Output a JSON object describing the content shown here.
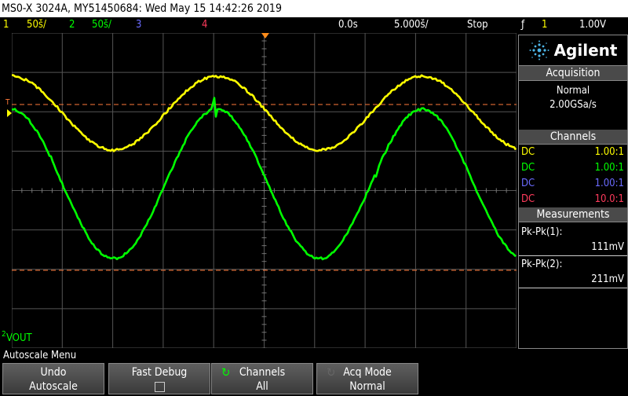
{
  "title": "MS0-X 3024A, MY51450684: Wed May 15 14:42:26 2019",
  "status": {
    "ch1_num": "1",
    "ch1_scale": "50š/",
    "ch2_num": "2",
    "ch2_scale": "50š/",
    "ch3_num": "3",
    "ch4_num": "4",
    "time_offset": "0.0s",
    "time_scale": "5.000š/",
    "run_state": "Stop",
    "trigger_symbol": "ƒ",
    "trigger_channel": "1",
    "trigger_level": "1.00V"
  },
  "markers": {
    "trigger_marker": "T",
    "ground_marker": "2",
    "vout_label": "VOUT"
  },
  "panel": {
    "brand": "Agilent",
    "acquisition_title": "Acquisition",
    "acquisition_mode": "Normal",
    "sample_rate": "2.00GSa/s",
    "channels_title": "Channels",
    "channels": [
      {
        "coupling": "DC",
        "ratio": "1.00:1",
        "color": "#ffff00"
      },
      {
        "coupling": "DC",
        "ratio": "1.00:1",
        "color": "#00ff00"
      },
      {
        "coupling": "DC",
        "ratio": "1.00:1",
        "color": "#6b6bff"
      },
      {
        "coupling": "DC",
        "ratio": "10.0:1",
        "color": "#ff3b5c"
      }
    ],
    "measurements_title": "Measurements",
    "measurements": [
      {
        "name": "Pk-Pk(1):",
        "value": "111mV"
      },
      {
        "name": "Pk-Pk(2):",
        "value": "211mV"
      }
    ]
  },
  "softkeys": {
    "menu_title": "Autoscale Menu",
    "undo_top": "Undo",
    "undo_bottom": "Autoscale",
    "fast_debug": "Fast Debug",
    "channels_top": "Channels",
    "channels_bottom": "All",
    "acq_top": "Acq Mode",
    "acq_bottom": "Normal"
  },
  "waveforms": {
    "ch1_color": "#ffff00",
    "ch2_color": "#00ff00",
    "ref_line_color": "#ff7a3a"
  }
}
